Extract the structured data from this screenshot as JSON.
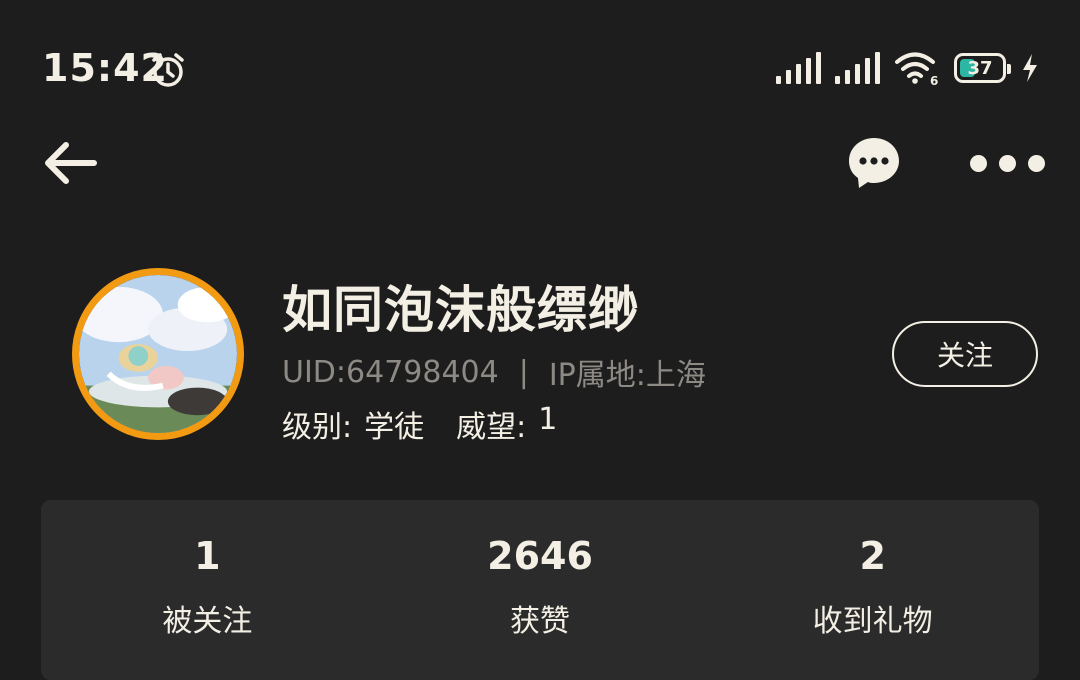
{
  "status_bar": {
    "time": "15:42",
    "battery_level": "37",
    "battery_fraction": 0.37,
    "wifi_badge": "6",
    "icons": [
      "alarm-icon",
      "signal-icon",
      "signal-icon",
      "wifi-icon",
      "battery-icon",
      "charging-icon"
    ]
  },
  "nav": {
    "icons": [
      "back-arrow-icon",
      "message-bubble-icon",
      "more-dots-icon"
    ]
  },
  "profile": {
    "username": "如同泡沫般缥缈",
    "uid": "UID:64798404",
    "separator": "|",
    "ip_location": "IP属地:上海",
    "level_label": "级别:",
    "level_value": "学徒",
    "prestige_label": "威望:",
    "prestige_value": "1",
    "follow_button": "关注",
    "avatar_ring_color": "#f29b12"
  },
  "stats": [
    {
      "value": "1",
      "label": "被关注"
    },
    {
      "value": "2646",
      "label": "获赞"
    },
    {
      "value": "2",
      "label": "收到礼物"
    }
  ],
  "colors": {
    "background": "#1d1d1d",
    "text": "#f3efe4",
    "muted": "#8d8a85",
    "card": "#2b2b2b",
    "battery_accent": "#2db6a4"
  }
}
